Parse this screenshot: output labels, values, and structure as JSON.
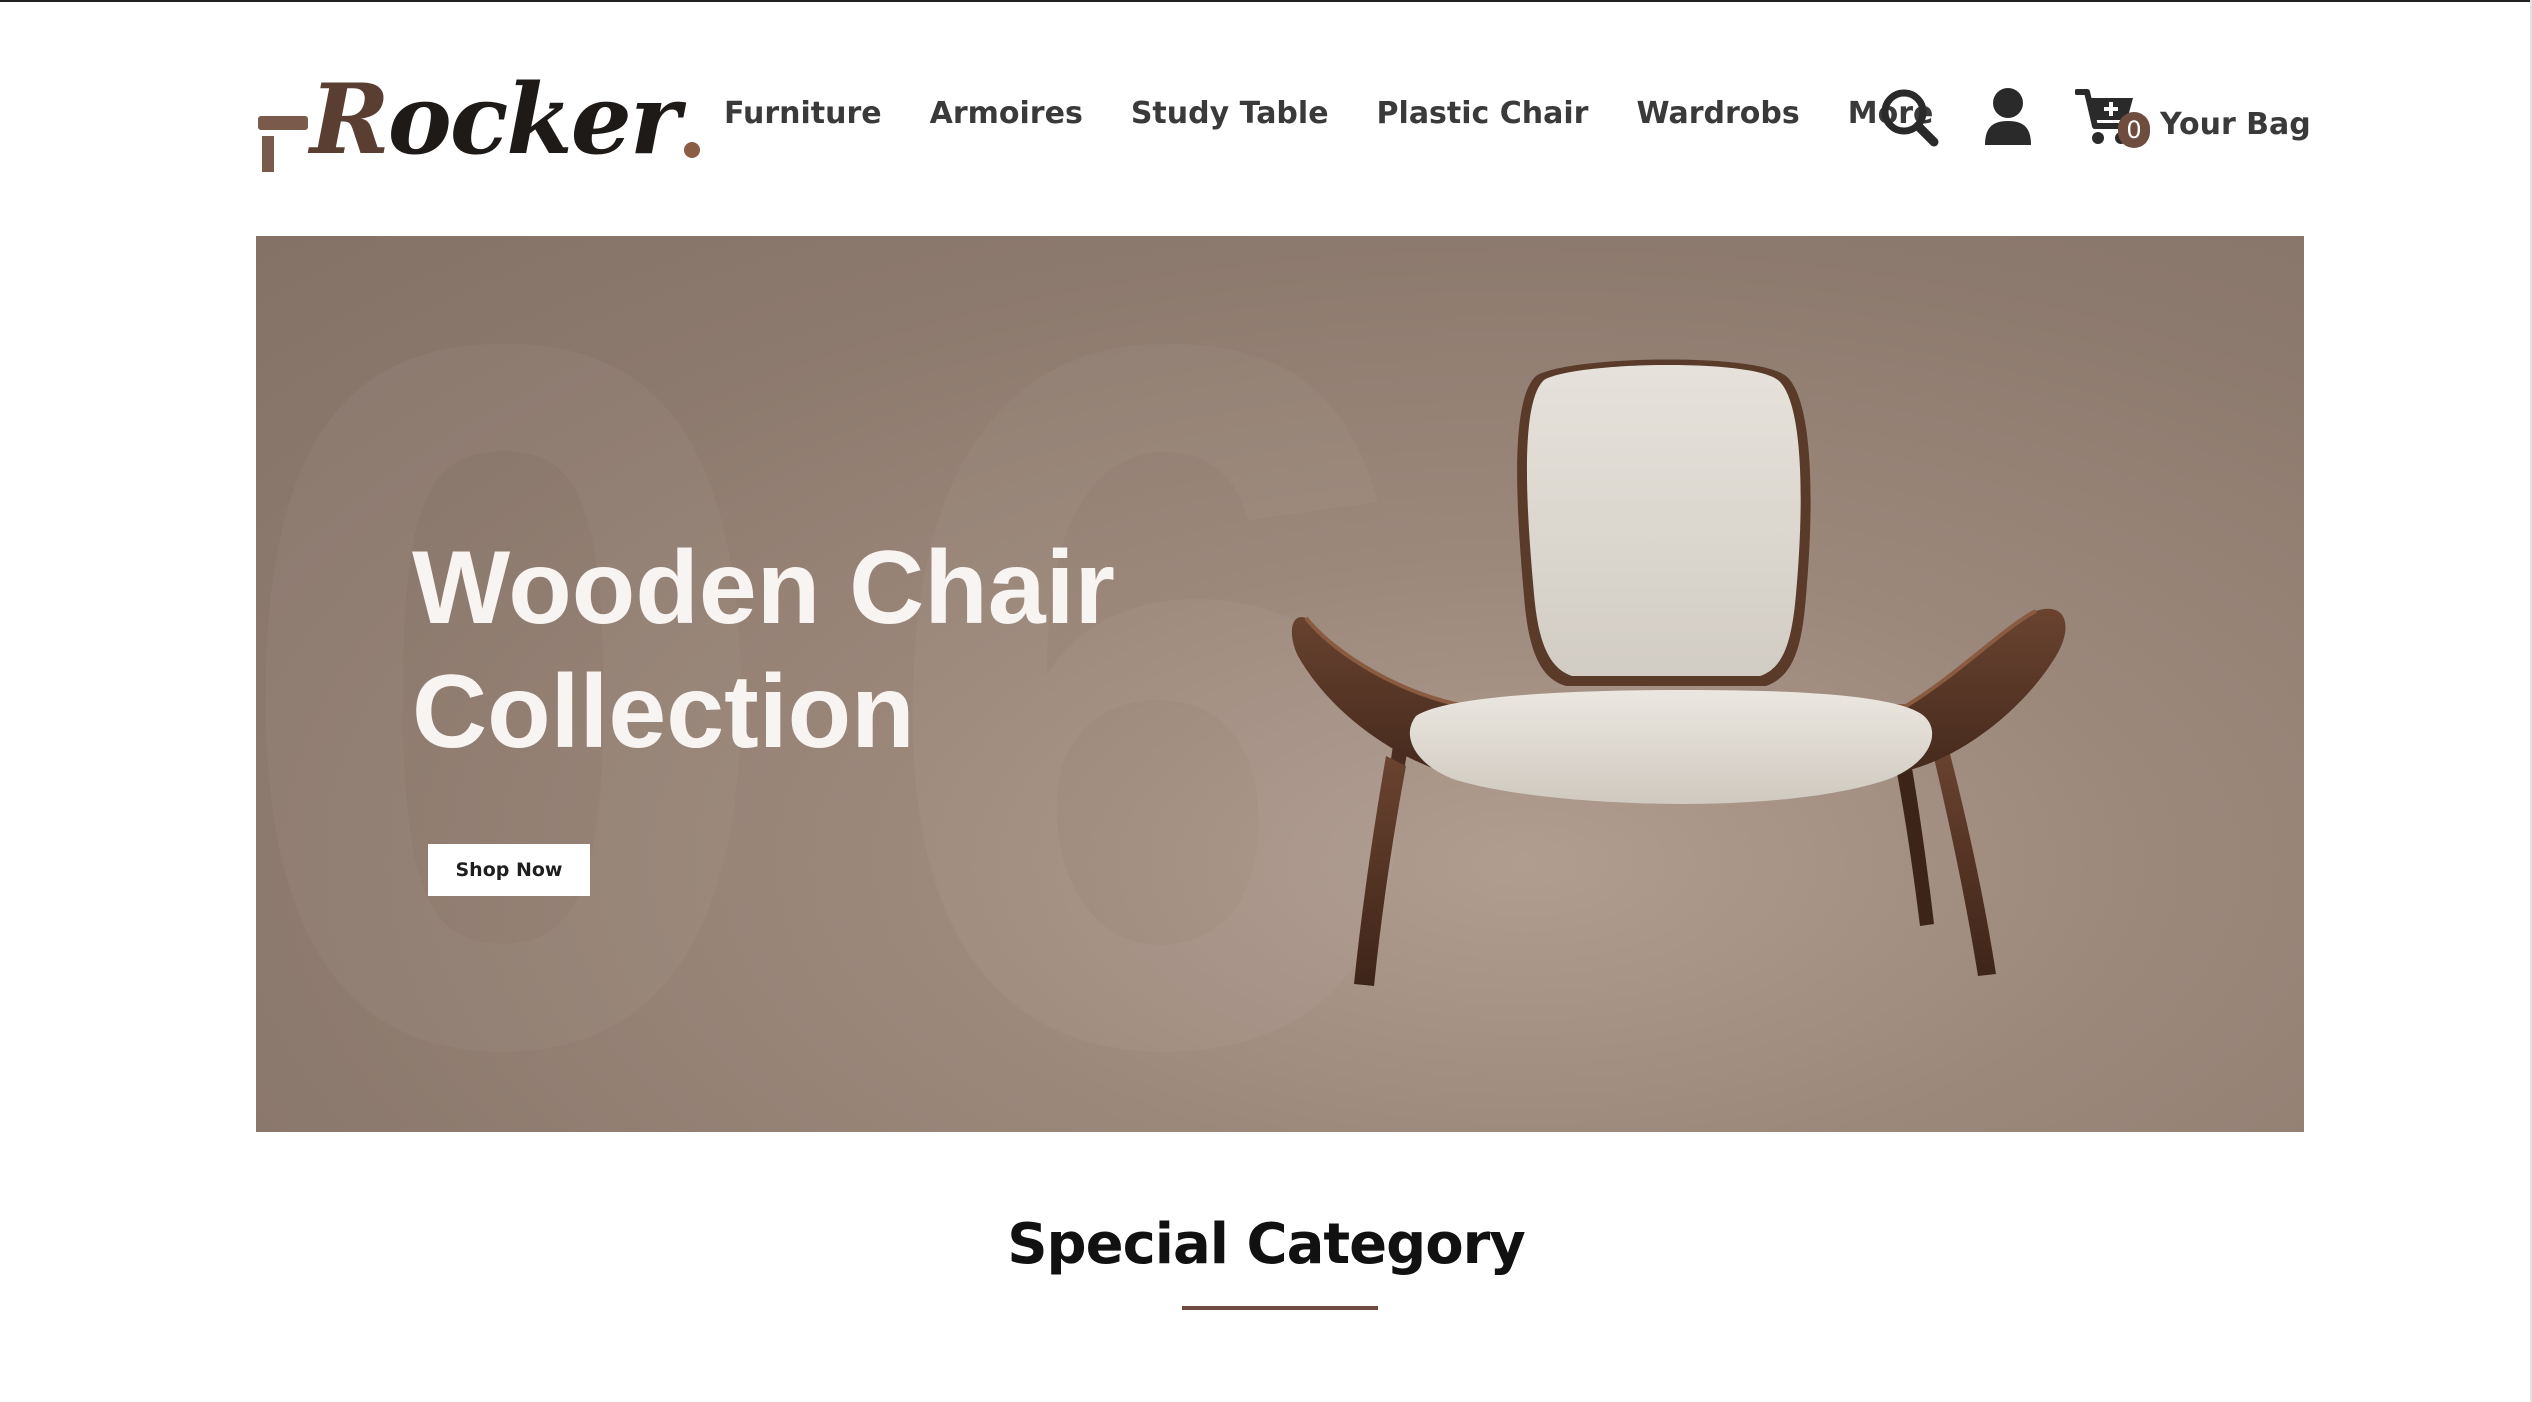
{
  "brand": {
    "logo_text": "Rocker",
    "logo_text_first": "R",
    "logo_text_rest": "ocker",
    "accent_color": "#6e4d3e"
  },
  "nav": {
    "items": [
      {
        "label": "Furniture"
      },
      {
        "label": "Armoires"
      },
      {
        "label": "Study Table"
      },
      {
        "label": "Plastic Chair"
      },
      {
        "label": "Wardrobs"
      },
      {
        "label": "More"
      }
    ]
  },
  "header_actions": {
    "search_icon": "search-icon",
    "account_icon": "user-icon",
    "cart_icon": "cart-plus-icon",
    "cart_count": "0",
    "bag_label": "Your Bag"
  },
  "hero": {
    "title_line1": "Wooden Chair",
    "title_line2": "Collection",
    "button_label": "Shop Now",
    "background_color": "#9c887b"
  },
  "section": {
    "title": "Special Category"
  }
}
